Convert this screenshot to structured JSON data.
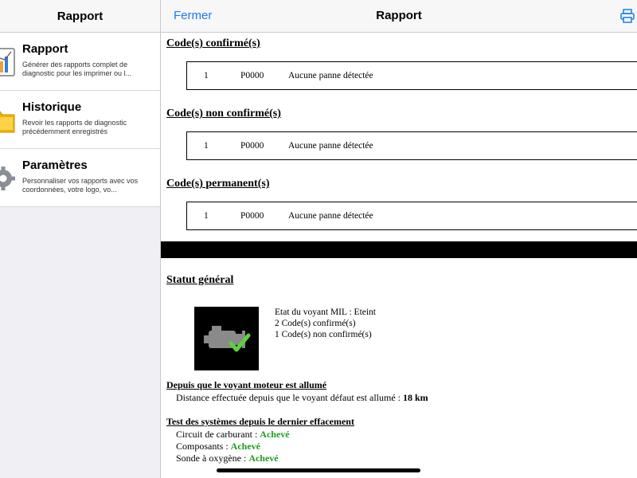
{
  "sidebar": {
    "title": "Rapport",
    "items": [
      {
        "label": "Rapport",
        "subtitle": "Générer des rapports complet de diagnostic pour les imprimer ou l...",
        "icon": "report-chart-icon"
      },
      {
        "label": "Historique",
        "subtitle": "Revoir les rapports de diagnostic précédemment enregistrés",
        "icon": "folder-history-icon"
      },
      {
        "label": "Paramètres",
        "subtitle": "Personnaliser vos rapports avec vos coordonnées, votre logo, vo...",
        "icon": "settings-gear-icon"
      }
    ]
  },
  "header": {
    "close_label": "Fermer",
    "title": "Rapport",
    "print_icon": "printer-icon"
  },
  "report": {
    "sections": [
      {
        "title": "Code(s) confirmé(s)",
        "rows": [
          {
            "num": "1",
            "code": "P0000",
            "desc": "Aucune panne détectée"
          }
        ]
      },
      {
        "title": "Code(s) non confirmé(s)",
        "rows": [
          {
            "num": "1",
            "code": "P0000",
            "desc": "Aucune panne détectée"
          }
        ]
      },
      {
        "title": "Code(s) permanent(s)",
        "rows": [
          {
            "num": "1",
            "code": "P0000",
            "desc": "Aucune panne détectée"
          }
        ]
      }
    ],
    "status": {
      "title": "Statut général",
      "icon": "engine-check-icon",
      "lines": [
        "Etat du voyant MIL : Eteint",
        "2 Code(s) confirmé(s)",
        "1 Code(s) non confirmé(s)"
      ]
    },
    "since_mil": {
      "title": "Depuis que le voyant moteur est allumé",
      "label": "Distance effectuée depuis que le voyant défaut est allumé : ",
      "value": "18 km"
    },
    "tests": {
      "title": "Test des systèmes depuis le dernier effacement",
      "items": [
        {
          "label": "Circuit de carburant : ",
          "status": "Achevé"
        },
        {
          "label": "Composants : ",
          "status": "Achevé"
        },
        {
          "label": "Sonde à oxygène : ",
          "status": "Achevé"
        }
      ]
    }
  },
  "colors": {
    "accent": "#1a7cf2",
    "success": "#1e9b1e"
  }
}
